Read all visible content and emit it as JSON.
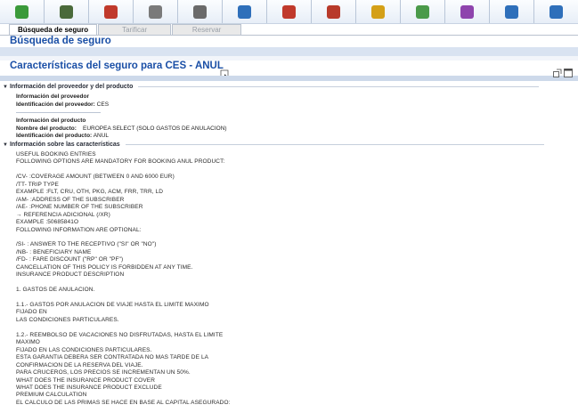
{
  "toolbar": {
    "icons": [
      {
        "name": "home-icon",
        "color": "#3a9a3a"
      },
      {
        "name": "globe-icon",
        "color": "#4a6a3a"
      },
      {
        "name": "person-icon",
        "color": "#c0392b"
      },
      {
        "name": "flight-icon",
        "color": "#7a7a7a"
      },
      {
        "name": "hotel-icon",
        "color": "#6a6a6a"
      },
      {
        "name": "car-icon",
        "color": "#2e6fba"
      },
      {
        "name": "rail-icon",
        "color": "#c0392b"
      },
      {
        "name": "agent-icon",
        "color": "#b83a2a"
      },
      {
        "name": "umbrella-icon",
        "color": "#d4a017"
      },
      {
        "name": "services-icon",
        "color": "#4a9a4a"
      },
      {
        "name": "notes-icon",
        "color": "#8e44ad"
      },
      {
        "name": "document-icon",
        "color": "#2e6fba"
      },
      {
        "name": "info-icon",
        "color": "#2e6fba"
      }
    ]
  },
  "tabs": [
    {
      "label": "Búsqueda de seguro",
      "active": true
    },
    {
      "label": "Tarificar",
      "active": false
    },
    {
      "label": "Reservar",
      "active": false
    }
  ],
  "page_title": "Búsqueda de seguro",
  "section_title": "Características del seguro para CES - ANUL",
  "provider_section": {
    "header": "Información del proveedor y del producto",
    "provider_heading": "Información del proveedor",
    "provider_id_label": "Identificación del proveedor:",
    "provider_id_value": "CES",
    "product_heading": "Información del producto",
    "product_name_label": "Nombre del producto:",
    "product_name_value": "EUROPEA SELECT (SOLO GASTOS DE ANULACION)",
    "product_id_label": "Identificación del producto:",
    "product_id_value": "ANUL"
  },
  "features_section": {
    "header": "Información sobre las características",
    "lines": [
      "USEFUL BOOKING ENTRIES",
      "FOLLOWING OPTIONS ARE MANDATORY FOR BOOKING ANUL PRODUCT:",
      "",
      "/CV- :COVERAGE AMOUNT (BETWEEN 0 AND 6000 EUR)",
      "/TT- TRIP TYPE",
      "EXAMPLE :FLT, CRU, OTH, PKG, ACM, FRR, TRR, LD",
      "/AM- :ADDRESS OF THE SUBSCRIBER",
      "/AE- :PHONE NUMBER OF THE SUBSCRIBER",
      "→ REFERENCIA ADICIONAL (/XR)",
      "EXAMPLE :50685841O",
      "FOLLOWING INFORMATION ARE OPTIONAL:",
      "",
      "/SI- : ANSWER TO THE RECEPTIVO (\"SI\" OR \"NO\")",
      "/NB- : BENEFICIARY NAME",
      "/FD- : FARE DISCOUNT (\"RP\" OR \"PF\")",
      "CANCELLATION OF THIS POLICY IS FORBIDDEN AT ANY TIME.",
      "INSURANCE PRODUCT DESCRIPTION",
      "",
      "1. GASTOS DE ANULACION.",
      "",
      "1.1.- GASTOS POR ANULACION DE VIAJE HASTA EL LIMITE MAXIMO",
      "FIJADO EN",
      "LAS CONDICIONES PARTICULARES.",
      "",
      "1.2.- REEMBOLSO DE VACACIONES NO DISFRUTADAS, HASTA EL LIMITE",
      "MAXIMO",
      "FIJADO EN LAS CONDICIONES PARTICULARES.",
      "ESTA GARANTIA DEBERA SER CONTRATADA NO MAS TARDE DE LA",
      "CONFIRMACION DE LA RESERVA DEL VIAJE.",
      "PARA CRUCEROS, LOS PRECIOS SE INCREMENTAN UN 50%.",
      "WHAT DOES THE INSURANCE PRODUCT COVER",
      "WHAT DOES THE INSURANCE PRODUCT EXCLUDE",
      "PREMIUM CALCULATION",
      "EL CALCULO DE LAS PRIMAS SE HACE EN BASE AL CAPITAL ASEGURADO:"
    ]
  }
}
